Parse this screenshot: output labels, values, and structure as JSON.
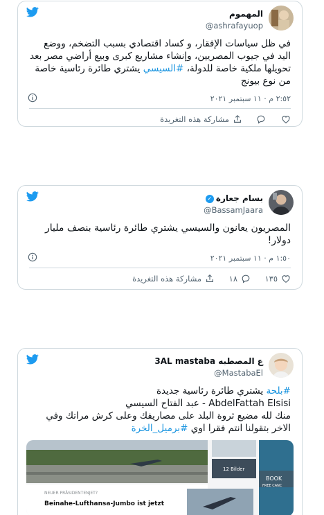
{
  "tweets": [
    {
      "name": "المهموم",
      "handle": "@ashrafayuop",
      "text_before": "في ظل سياسات الإفقار، و كساد اقتصادي بسبب التضخم، ووضع اليد في جيوب المصريين، وإنشاء مشاريع كبرى وبيع أراضي مصر بعد تحويلها ملكية خاصة للدولة، ",
      "hashtag": "#السيسي",
      "text_after": " يشتري طائرة رئاسية خاصة من نوع بيونج",
      "date": "٢:٥٢ م · ١١ سبتمبر ٢٠٢١",
      "share_label": "مشاركة هذه التغريدة",
      "likes": "",
      "replies": ""
    },
    {
      "name": "بسام جعارة",
      "handle": "@BassamJaara",
      "text": "المصريون يعانون والسيسي يشتري طائرة رئاسية بنصف مليار دولار!",
      "date": "١:٥٠ م · ١١ سبتمبر ٢٠٢١",
      "share_label": "مشاركة هذه التغريدة",
      "likes": "١٣٥",
      "replies": "١٨"
    },
    {
      "name": "ع المصطبه 3AL mastaba",
      "handle": "@MastabaEl",
      "hashtag1": "#بلحة",
      "line1_rest": " يشتري طائرة رئاسية جديدة",
      "line2": "AbdelFattah Elsisi - عبد الفتاح السيسي",
      "line3": "منك لله مضيع ثروة البلد على مصاريفك وعلى كرش مراتك وفي الاخر بتقولنا انتم فقرا اوي ",
      "hashtag2": "#برميل_الخرة",
      "media": {
        "kicker": "NEUER PRÄSIDENTENJET?",
        "headline": "Beinahe-Lufthansa-Jumbo ist jetzt",
        "bilder": "12 Bilder",
        "book": "BOOK",
        "free": "FREE CANC"
      }
    }
  ],
  "colors": {
    "link": "#1b95e0",
    "twitter_blue": "#1d9bf0",
    "grey": "#536471",
    "like_red": "#f91880"
  }
}
